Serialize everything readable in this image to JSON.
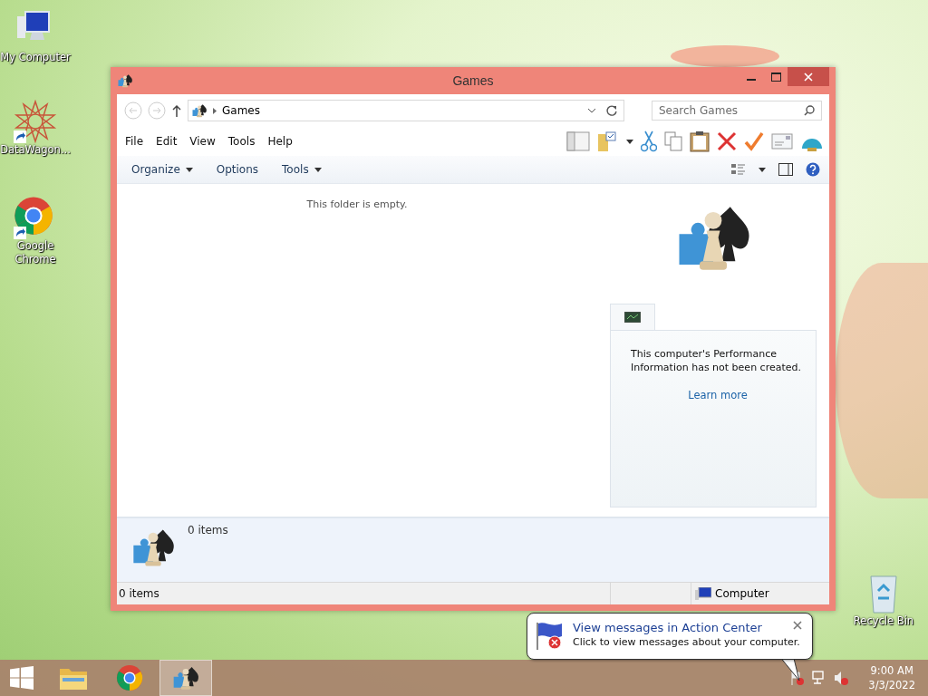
{
  "desktop_icons": [
    {
      "kind": "computer",
      "label": "My Computer",
      "shortcut": false
    },
    {
      "kind": "star",
      "label": "DataWagon...",
      "shortcut": true
    },
    {
      "kind": "chrome",
      "label": "Google Chrome",
      "shortcut": true
    }
  ],
  "recycle_bin": {
    "label": "Recycle Bin"
  },
  "window": {
    "title": "Games",
    "address": {
      "path": "Games"
    },
    "search": {
      "placeholder": "Search Games"
    },
    "menu": [
      "File",
      "Edit",
      "View",
      "Tools",
      "Help"
    ],
    "commands": [
      {
        "label": "Organize",
        "dropdown": true
      },
      {
        "label": "Options",
        "dropdown": false
      },
      {
        "label": "Tools",
        "dropdown": true
      }
    ],
    "empty_message": "This folder is empty.",
    "performance": {
      "text": "This computer's Performance Information has not been created.",
      "link": "Learn more"
    },
    "details": {
      "count": "0 items"
    },
    "status_bar": {
      "left": "0 items",
      "right": "Computer"
    }
  },
  "notification": {
    "title": "View messages in Action Center",
    "body": "Click to view messages about your computer."
  },
  "taskbar": {
    "apps": [
      {
        "kind": "explorer",
        "selected": false
      },
      {
        "kind": "chrome",
        "selected": false
      },
      {
        "kind": "games",
        "selected": true
      }
    ],
    "clock": {
      "time": "9:00 AM",
      "date": "3/3/2022"
    }
  }
}
